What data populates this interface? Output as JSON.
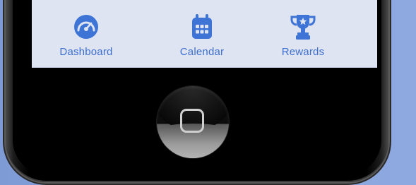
{
  "nav": {
    "items": [
      {
        "label": "Dashboard",
        "icon": "gauge-icon"
      },
      {
        "label": "Calendar",
        "icon": "calendar-icon"
      },
      {
        "label": "Rewards",
        "icon": "trophy-icon"
      }
    ]
  },
  "colors": {
    "accent": "#3d6fd0",
    "nav_background": "#dfe4f2",
    "page_background": "#88a2dc",
    "phone": "#000000"
  }
}
